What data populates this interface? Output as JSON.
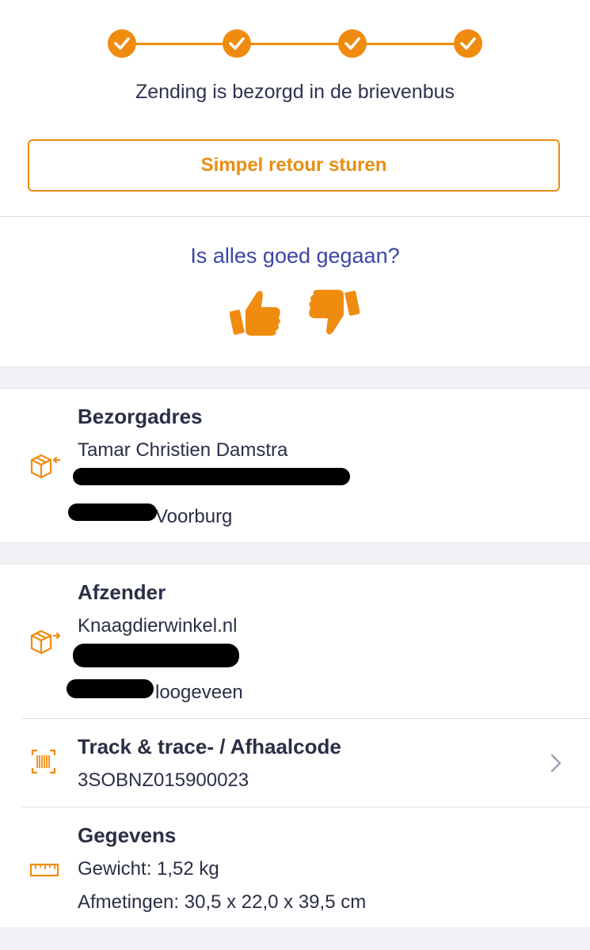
{
  "progress": {
    "steps_completed": 4,
    "steps_total": 4
  },
  "status": {
    "text": "Zending is bezorgd in de brievenbus"
  },
  "retour": {
    "label": "Simpel retour sturen"
  },
  "feedback": {
    "question": "Is alles goed gegaan?"
  },
  "delivery": {
    "title": "Bezorgadres",
    "name": "Tamar Christien Damstra",
    "city_suffix": "Voorburg"
  },
  "sender": {
    "title": "Afzender",
    "name": "Knaagdierwinkel.nl",
    "city_suffix": "loogeveen"
  },
  "tracking": {
    "title": "Track & trace- / Afhaalcode",
    "code": "3SOBNZ015900023"
  },
  "details": {
    "title": "Gegevens",
    "weight": "Gewicht: 1,52 kg",
    "dimensions": "Afmetingen: 30,5 x 22,0 x 39,5 cm"
  },
  "colors": {
    "accent": "#ef8c10",
    "link": "#3b45a7",
    "text": "#2a2f45"
  },
  "icons": [
    "check-icon",
    "thumbs-up-icon",
    "thumbs-down-icon",
    "package-in-icon",
    "package-out-icon",
    "barcode-icon",
    "ruler-icon",
    "chevron-right-icon"
  ]
}
